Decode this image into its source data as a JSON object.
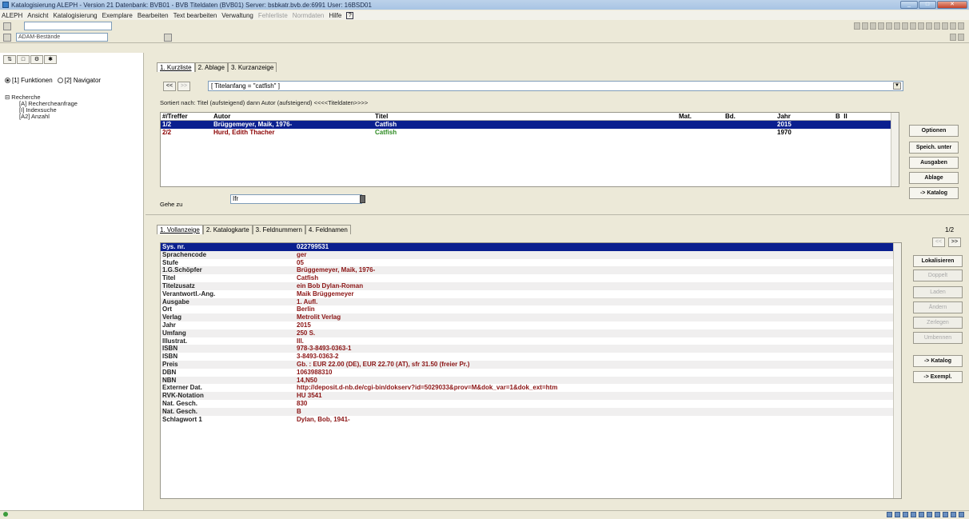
{
  "window": {
    "title": "Katalogisierung ALEPH - Version 21 Datenbank: BVB01 - BVB Titeldaten (BVB01) Server: bsbkatr.bvb.de:6991 User: 16BSD01"
  },
  "menu": {
    "items": [
      "ALEPH",
      "Ansicht",
      "Katalogisierung",
      "Exemplare",
      "Bearbeiten",
      "Text bearbeiten",
      "Verwaltung",
      "Fehlerliste",
      "Normdaten",
      "Hilfe"
    ],
    "disabled": [
      "Fehlerliste",
      "Normdaten"
    ],
    "help_icon": "?"
  },
  "toolbar": {
    "library_select": "ADAM-Bestände"
  },
  "left_panel": {
    "radio_functions": "[1] Funktionen",
    "radio_navigate": "[2] Navigator",
    "tree_root": "Recherche",
    "tree_items": [
      "[A] Rechercheanfrage",
      "[I] Indexsuche",
      "[A2] Anzahl"
    ]
  },
  "search": {
    "tabs": [
      "1. Kurzliste",
      "2. Ablage",
      "3. Kurzanzeige"
    ],
    "nav_prev": "<<",
    "nav_next": ">>",
    "query": "[ Titelanfang = \"catfish\" ]",
    "description": "Sortiert nach: Titel (aufsteigend) dann Autor (aufsteigend) <<<<Titeldaten>>>>",
    "columns": [
      "#/Treffer",
      "Autor",
      "Titel",
      "Mat.",
      "Bd.",
      "Jahr",
      "B",
      "II"
    ],
    "rows": [
      {
        "treffer": "1/2",
        "autor": "Brüggemeyer, Maik, 1976-",
        "titel": "Catfish",
        "mat": "",
        "bd": "",
        "jahr": "2015",
        "b": "",
        "ii": ""
      },
      {
        "treffer": "2/2",
        "autor": "Hurd, Edith Thacher",
        "titel": "Catfish",
        "mat": "",
        "bd": "",
        "jahr": "1970",
        "b": "",
        "ii": ""
      }
    ],
    "goto_label": "Gehe zu",
    "goto_value": "Ifr",
    "buttons": [
      "Optionen",
      "Speich. unter",
      "Ausgaben",
      "Ablage",
      "-> Katalog"
    ]
  },
  "record": {
    "tabs": [
      "1. Vollanzeige",
      "2. Katalogkarte",
      "3. Feldnummern",
      "4. Feldnamen"
    ],
    "counter": "1/2",
    "nav_prev": "<<",
    "nav_next": ">>",
    "fields": [
      {
        "key": "Sys. nr.",
        "value": "022799531"
      },
      {
        "key": "Sprachencode",
        "value": "ger"
      },
      {
        "key": "Stufe",
        "value": "05"
      },
      {
        "key": "1.G.Schöpfer",
        "value": "Brüggemeyer, Maik, 1976-"
      },
      {
        "key": "Titel",
        "value": "Catfish"
      },
      {
        "key": "Titelzusatz",
        "value": "ein Bob Dylan-Roman"
      },
      {
        "key": "Verantwortl.-Ang.",
        "value": "Maik Brüggemeyer"
      },
      {
        "key": "Ausgabe",
        "value": "1. Aufl."
      },
      {
        "key": "Ort",
        "value": "Berlin"
      },
      {
        "key": "Verlag",
        "value": "Metrolit Verlag"
      },
      {
        "key": "Jahr",
        "value": "2015"
      },
      {
        "key": "Umfang",
        "value": "250 S."
      },
      {
        "key": "Illustrat.",
        "value": "Ill."
      },
      {
        "key": "ISBN",
        "value": "978-3-8493-0363-1"
      },
      {
        "key": "ISBN",
        "value": "3-8493-0363-2"
      },
      {
        "key": "Preis",
        "value": "Gb. : EUR 22.00 (DE), EUR 22.70 (AT), sfr 31.50 (freier Pr.)"
      },
      {
        "key": "DBN",
        "value": "1063988310"
      },
      {
        "key": "NBN",
        "value": "14,N50"
      },
      {
        "key": "Externer Dat.",
        "value": "http://deposit.d-nb.de/cgi-bin/dokserv?id=5029033&prov=M&dok_var=1&dok_ext=htm"
      },
      {
        "key": "RVK-Notation",
        "value": "HU 3541"
      },
      {
        "key": "Nat. Gesch.",
        "value": "830"
      },
      {
        "key": "Nat. Gesch.",
        "value": "B"
      },
      {
        "key": "Schlagwort 1",
        "value": "Dylan, Bob, 1941-"
      }
    ],
    "buttons": [
      "Lokalisieren",
      "Doppelt",
      "Laden",
      "Ändern",
      "Zerlegen",
      "Umbennen",
      "-> Katalog",
      "-> Exempl."
    ],
    "disabled_buttons": [
      "Doppelt",
      "Laden",
      "Ändern",
      "Zerlegen",
      "Umbennen"
    ]
  }
}
